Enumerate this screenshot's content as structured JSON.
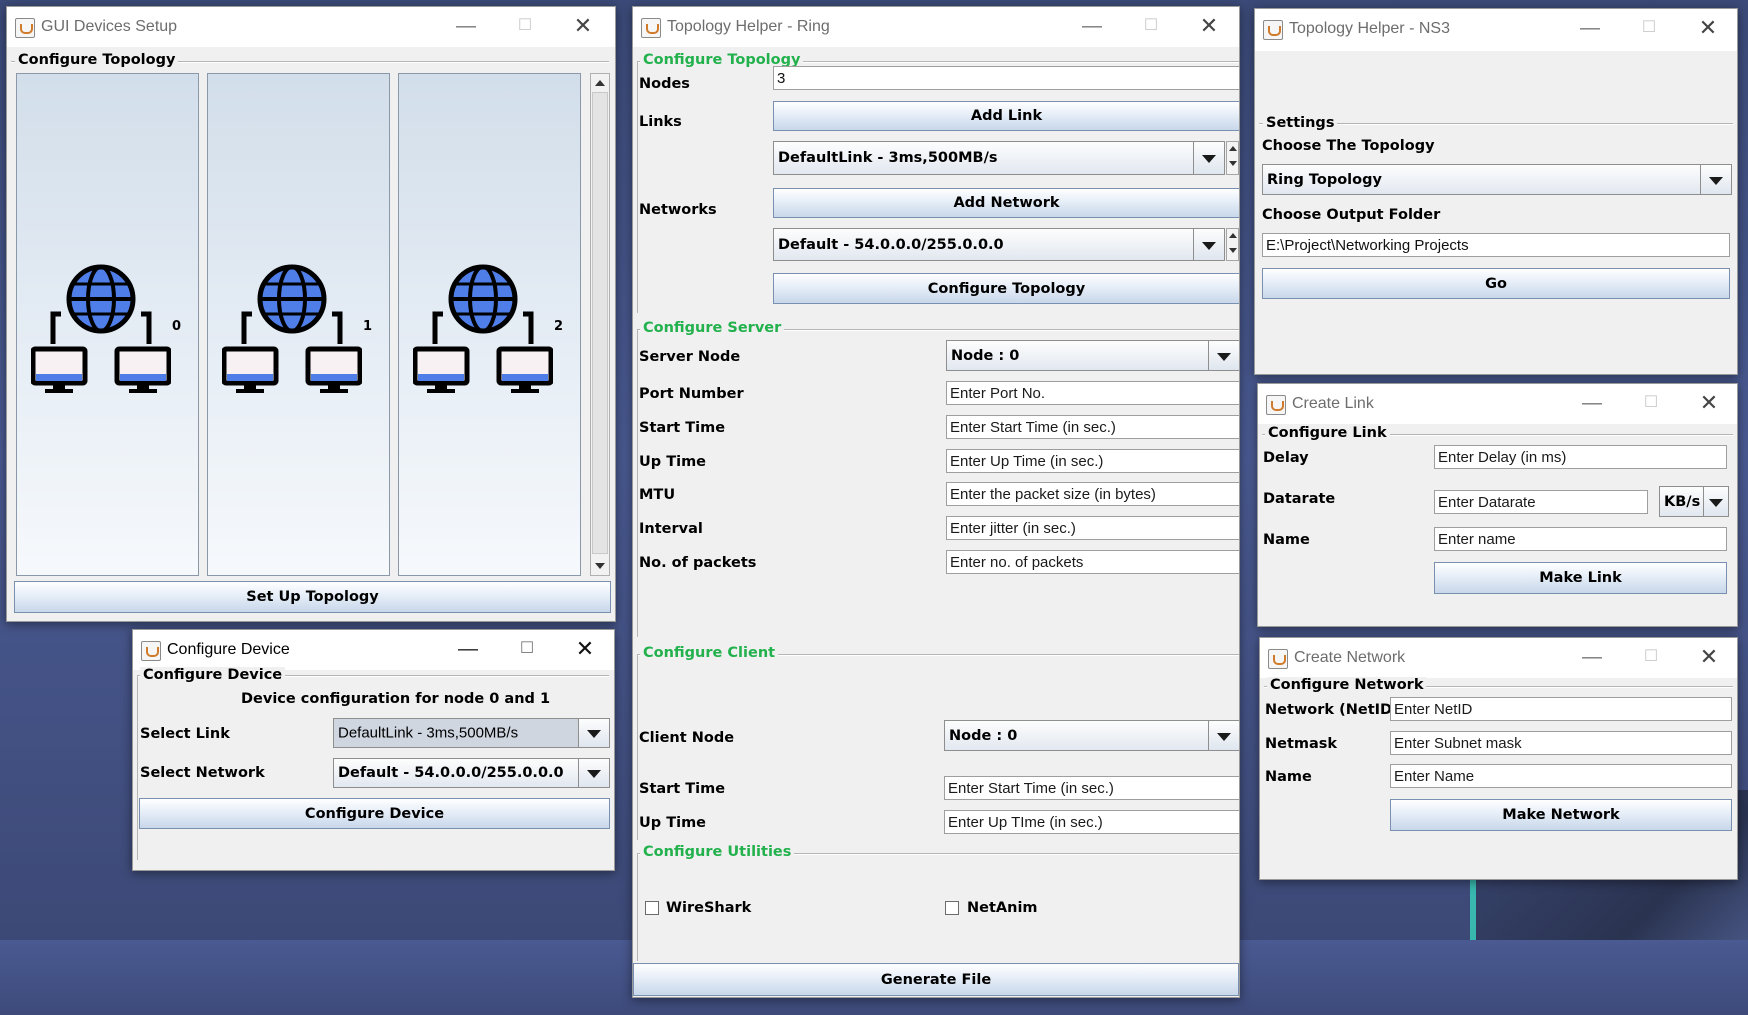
{
  "gui_devices_setup": {
    "title": "GUI Devices Setup",
    "section": "Configure Topology",
    "nodes": [
      "0",
      "1",
      "2"
    ],
    "setup_button": "Set Up Topology"
  },
  "configure_device": {
    "title": "Configure Device",
    "section": "Configure Device",
    "description": "Device configuration for node 0 and 1",
    "select_link_label": "Select Link",
    "select_link_value": "DefaultLink - 3ms,500MB/s",
    "select_network_label": "Select Network",
    "select_network_value": "Default - 54.0.0.0/255.0.0.0",
    "configure_button": "Configure Device"
  },
  "topology_ring": {
    "title": "Topology Helper - Ring",
    "topology_section": "Configure Topology",
    "nodes_label": "Nodes",
    "nodes_value": "3",
    "links_label": "Links",
    "add_link_button": "Add Link",
    "link_value": "DefaultLink - 3ms,500MB/s",
    "networks_label": "Networks",
    "add_network_button": "Add Network",
    "network_value": "Default - 54.0.0.0/255.0.0.0",
    "configure_topology_button": "Configure Topology",
    "server_section": "Configure Server",
    "server_node_label": "Server Node",
    "server_node_value": "Node : 0",
    "port_label": "Port Number",
    "port_placeholder": "Enter Port No.",
    "start_time_label": "Start Time",
    "start_time_placeholder": "Enter Start Time (in sec.)",
    "up_time_label": "Up Time",
    "up_time_placeholder": "Enter Up Time (in sec.)",
    "mtu_label": "MTU",
    "mtu_placeholder": "Enter the packet size (in bytes)",
    "interval_label": "Interval",
    "interval_placeholder": "Enter jitter (in sec.)",
    "packets_label": "No. of packets",
    "packets_placeholder": "Enter no. of packets",
    "client_section": "Configure Client",
    "client_node_label": "Client Node",
    "client_node_value": "Node : 0",
    "client_start_label": "Start Time",
    "client_start_placeholder": "Enter Start Time (in sec.)",
    "client_up_label": "Up Time",
    "client_up_placeholder": "Enter Up TIme (in sec.)",
    "utilities_section": "Configure Utilities",
    "wireshark_label": "WireShark",
    "netanim_label": "NetAnim",
    "generate_button": "Generate File"
  },
  "topology_ns3": {
    "title": "Topology Helper - NS3",
    "section": "Settings",
    "choose_topology_label": "Choose The Topology",
    "topology_value": "Ring Topology",
    "choose_folder_label": "Choose Output Folder",
    "folder_value": "E:\\Project\\Networking Projects",
    "go_button": "Go"
  },
  "create_link": {
    "title": "Create Link",
    "section": "Configure Link",
    "delay_label": "Delay",
    "delay_placeholder": "Enter Delay (in ms)",
    "datarate_label": "Datarate",
    "datarate_placeholder": "Enter Datarate",
    "unit_value": "KB/s",
    "name_label": "Name",
    "name_placeholder": "Enter name",
    "make_button": "Make Link"
  },
  "create_network": {
    "title": "Create Network",
    "section": "Configure Network",
    "netid_label": "Network (NetID)",
    "netid_placeholder": "Enter NetID",
    "netmask_label": "Netmask",
    "netmask_placeholder": "Enter Subnet mask",
    "name_label": "Name",
    "name_placeholder": "Enter Name",
    "make_button": "Make Network"
  },
  "window_controls": {
    "minimize": "—",
    "maximize": "☐",
    "close": "✕"
  },
  "colors": {
    "section_green": "#22b14c",
    "globe_blue": "#4f7ee8",
    "desktop": "#3b4a78"
  }
}
